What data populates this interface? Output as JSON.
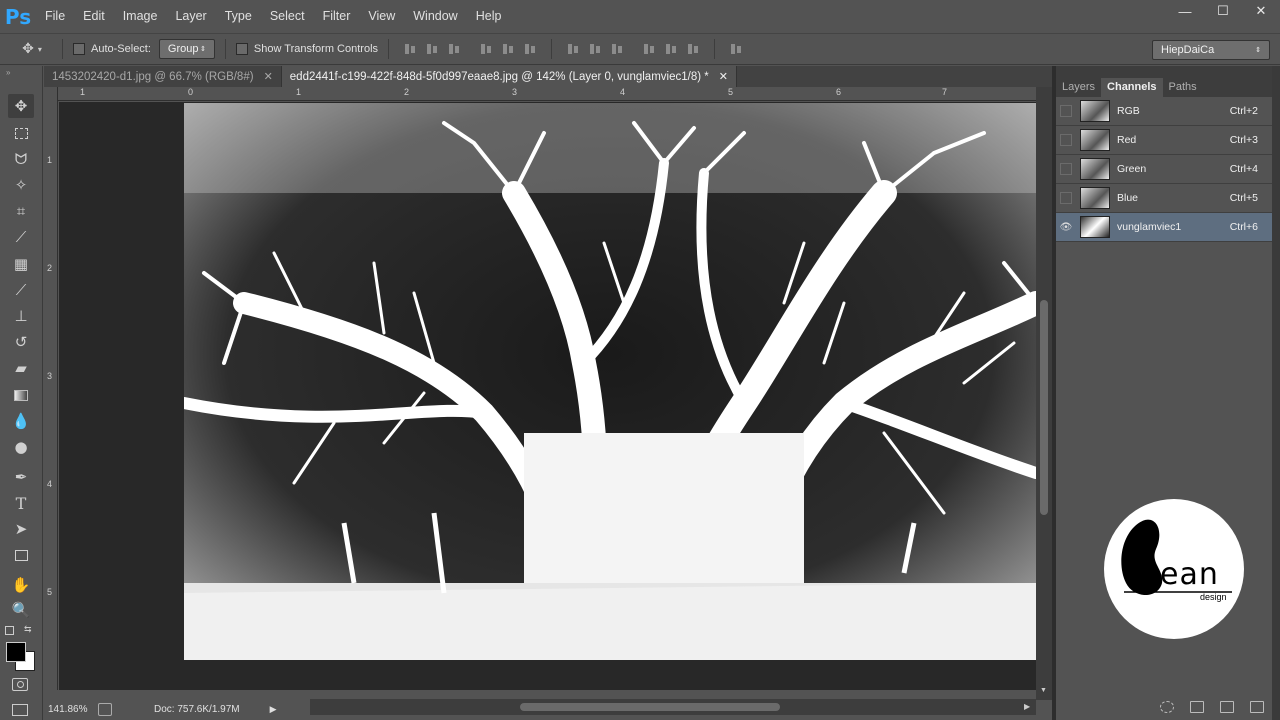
{
  "app": {
    "logo": "Ps"
  },
  "menu": [
    "File",
    "Edit",
    "Image",
    "Layer",
    "Type",
    "Select",
    "Filter",
    "View",
    "Window",
    "Help"
  ],
  "window_controls": {
    "minimize": "—",
    "maximize": "☐",
    "close": "✕"
  },
  "options_bar": {
    "auto_select_label": "Auto-Select:",
    "auto_select_value": "Group",
    "show_transform_label": "Show Transform Controls",
    "workspace": "HiepDaiCa"
  },
  "tabs": [
    {
      "label": "1453202420-d1.jpg @ 66.7% (RGB/8#)",
      "close": "✕"
    },
    {
      "label": "edd2441f-c199-422f-848d-5f0d997eaae8.jpg @ 142% (Layer 0, vunglamviec1/8) *",
      "close": "✕"
    }
  ],
  "ruler": {
    "h_labels": [
      "1",
      "0",
      "1",
      "2",
      "3",
      "4",
      "5",
      "6",
      "7"
    ],
    "v_labels": [
      "1",
      "2",
      "3",
      "4",
      "5"
    ]
  },
  "status": {
    "zoom": "141.86%",
    "doc": "Doc: 757.6K/1.97M"
  },
  "panel": {
    "tabs": [
      "Layers",
      "Channels",
      "Paths"
    ],
    "active_tab": "Channels",
    "channels": [
      {
        "name": "RGB",
        "shortcut": "Ctrl+2",
        "visible": false
      },
      {
        "name": "Red",
        "shortcut": "Ctrl+3",
        "visible": false
      },
      {
        "name": "Green",
        "shortcut": "Ctrl+4",
        "visible": false
      },
      {
        "name": "Blue",
        "shortcut": "Ctrl+5",
        "visible": false
      },
      {
        "name": "vunglamviec1",
        "shortcut": "Ctrl+6",
        "visible": true
      }
    ]
  },
  "watermark": {
    "text": "ean",
    "subtext": "design"
  },
  "colors": {
    "accent": "#31a8ff",
    "panel_bg": "#535353",
    "selected_row": "#5e6e80"
  }
}
